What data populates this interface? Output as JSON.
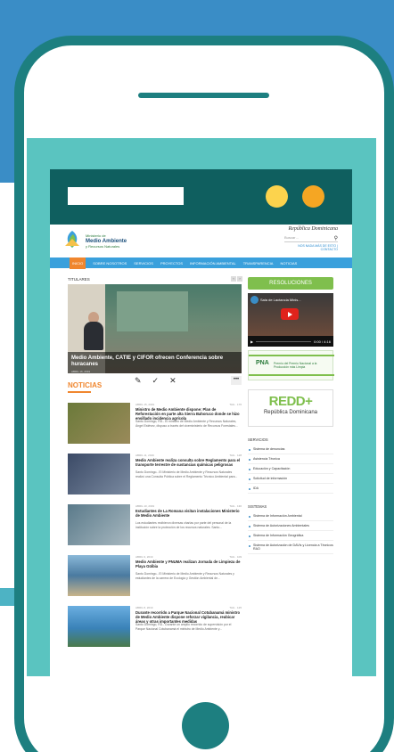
{
  "site": {
    "logo_line1": "Ministerio de",
    "logo_line2": "Medio Ambiente",
    "logo_line3": "y Recursos Naturales",
    "rd_title": "República Dominicana",
    "search_placeholder": "Buscar…",
    "rd_link": "NOS NADA MÁS DE ESTO | CONTACTO"
  },
  "nav": {
    "items": [
      "INICIO",
      "SOBRE NOSOTROS",
      "SERVICIOS",
      "PROYECTOS",
      "INFORMACIÓN AMBIENTAL",
      "TRANSPARENCIA",
      "NOTICIAS"
    ]
  },
  "titulares": {
    "label": "TITULARES",
    "prev": "‹",
    "next": "›",
    "hero_title": "Medio Ambiente, CATIE y CIFOR ofrecen Conferencia sobre huracanes",
    "hero_date": "ABRIL 16, 2019"
  },
  "noticias": {
    "label": "NOTICIAS",
    "tools": {
      "edit": "✎",
      "check": "✓",
      "close": "✕",
      "more": "•••"
    },
    "items": [
      {
        "date": "ABRIL 15, 2019",
        "meta": "TAG · 176",
        "title": "Ministro de Medio Ambiente dispone: Plan de Reforestación en parte alta  Sierra Bahoruco donde se hizo ensillado incidencia agrícola",
        "excerpt": "Santo Domingo, RD.- El ministro de Medio Ambiente y Recursos Naturales, Ángel Estévez, dispuso a través del viceministerio de Recursos Forestales...",
        "img": "#6b7a3a"
      },
      {
        "date": "ABRIL 11, 2019",
        "meta": "TAG · 128",
        "title": "Medio Ambiente realiza consulta sobre Reglamento para el transporte terrestre de sustancias químicas peligrosas",
        "excerpt": "Santo Domingo.- El Ministerio de Medio Ambiente y Recursos Naturales realizó una Consulta Pública sobre el Reglamento Técnico Ambiental para...",
        "img": "#3b4a66"
      },
      {
        "date": "ABRIL 10, 2019",
        "meta": "TAG · 130",
        "title": "Estudiantes de La Romana visitan instalaciones Ministerio de Medio Ambiente",
        "excerpt": "Los estudiantes recibieron diversas charlas por parte del personal de la institución sobre la protección de los recursos naturales. Santo...",
        "img": "#5a7a8a"
      },
      {
        "date": "ABRIL 9, 2019",
        "meta": "TAG · 109",
        "title": "Medio Ambiente y PNUMA realizan Jornada de Limpieza de Playa Güibia",
        "excerpt": "Santo Domingo.- El Ministerio de Medio Ambiente y Recursos Naturales y estudiantes de la carrera de Ecología y Gestión Ambiental de...",
        "img": "#4a7aa0"
      },
      {
        "date": "ABRIL 8, 2019",
        "meta": "TAG · 125",
        "title": "Durante recorrido a Parque Nacional Cotubanamá ministro de Medio Ambiente dispone reforzar vigilancia, reubicar áreas y otras importantes medidas",
        "excerpt": "Santo Domingo, RD.- Durante un amplio recorrido de supervisión por el Parque Nacional Cotubanamá el ministro de Medio Ambiente y...",
        "img": "#3a82b8"
      }
    ]
  },
  "sidebar": {
    "resoluciones": "RESOLUCIONES",
    "video_title": "Sala de Lactancia Minis...",
    "video_time": "0:00 / 4:16",
    "premio_logo": "PNA",
    "premio_text": "Premio del Premio Nacional a la Producción más Limpia",
    "redd_main": "REDD+",
    "redd_sub": "República Dominicana",
    "servicios_head": "SERVICIOS",
    "servicios": [
      "Sistema de denuncias",
      "Asistencia Técnica",
      "Educación y Capacitación",
      "Solicitud de información",
      "IDA"
    ],
    "sistemas_head": "SISTEMAS",
    "sistemas": [
      "Sistema de Información Ambiental",
      "Sistema de Autorizaciones Ambientales",
      "Sistema de Información Geográfica",
      "Sistema de Autorización de DAVIs y Licencia a Técnicos RAO"
    ]
  },
  "colors": {
    "frame": "#1d7f80",
    "screen": "#5ac4c0",
    "header": "#0f5f5f",
    "dot_yellow": "#fcd34d",
    "dot_orange": "#f5a623",
    "nav": "#3aa0dc",
    "accent": "#f0862e",
    "green": "#7fbf4d"
  }
}
